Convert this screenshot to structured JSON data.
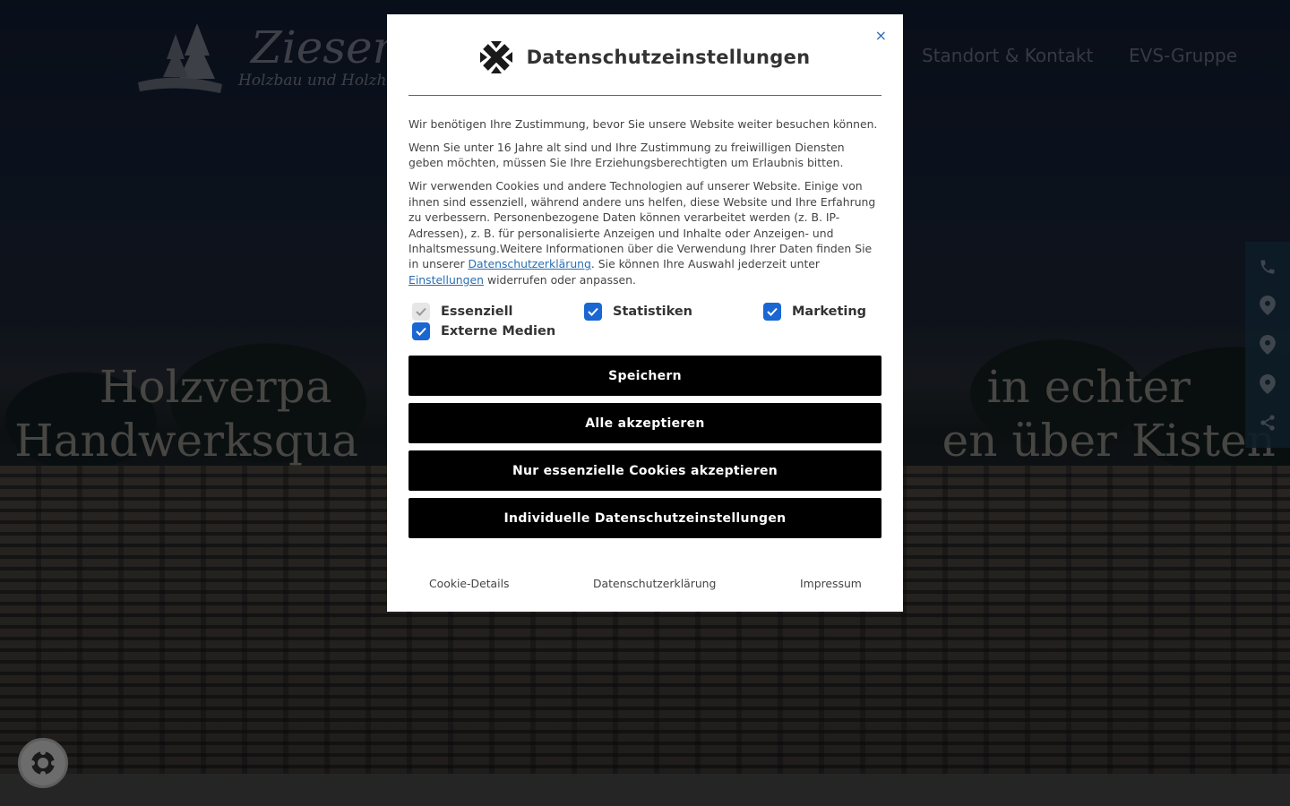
{
  "site": {
    "logo_title": "Ziesenhen",
    "logo_subtitle": "Holzbau und Holzhand",
    "nav": {
      "standort": "Standort & Kontakt",
      "evs": "EVS-Gruppe"
    },
    "hero_line1": "Holzverpa                                              in echter",
    "hero_line2": "Handwerksqua                                         en über Kisten"
  },
  "side_icons": [
    "phone-icon",
    "map-pin-icon",
    "map-pin-icon",
    "map-pin-icon",
    "share-icon"
  ],
  "modal": {
    "title": "Datenschutzeinstellungen",
    "close_symbol": "×",
    "para1": "Wir benötigen Ihre Zustimmung, bevor Sie unsere Website weiter besuchen können.",
    "para2": "Wenn Sie unter 16 Jahre alt sind und Ihre Zustimmung zu freiwilligen Diensten geben möchten, müssen Sie Ihre Erziehungsberechtigten um Erlaubnis bitten.",
    "para3_part1": "Wir verwenden Cookies und andere Technologien auf unserer Website. Einige von ihnen sind essenziell, während andere uns helfen, diese Website und Ihre Erfahrung zu verbessern. Personenbezogene Daten können verarbeitet werden (z. B. IP-Adressen), z. B. für personalisierte Anzeigen und Inhalte oder Anzeigen- und Inhaltsmessung.Weitere Informationen über die Verwendung Ihrer Daten finden Sie in unserer ",
    "para3_link1": "Datenschutzerklärung",
    "para3_part2": ". Sie können Ihre Auswahl jederzeit unter ",
    "para3_link2": "Einstellungen",
    "para3_part3": " widerrufen oder anpassen.",
    "checkboxes": {
      "essenziell": {
        "label": "Essenziell",
        "checked": true,
        "disabled": true
      },
      "statistiken": {
        "label": "Statistiken",
        "checked": true,
        "disabled": false
      },
      "marketing": {
        "label": "Marketing",
        "checked": true,
        "disabled": false
      },
      "externe_medien": {
        "label": "Externe Medien",
        "checked": true,
        "disabled": false
      }
    },
    "buttons": {
      "save": "Speichern",
      "accept_all": "Alle akzeptieren",
      "essential_only": "Nur essenzielle Cookies akzeptieren",
      "individual": "Individuelle Datenschutzeinstellungen"
    },
    "links": {
      "cookie_details": "Cookie-Details",
      "privacy": "Datenschutzerklärung",
      "imprint": "Impressum"
    }
  },
  "colors": {
    "accent": "#1a66d2",
    "link": "#2a6fb2",
    "button_bg": "#000000",
    "overlay": "rgba(0,0,0,0.5)"
  }
}
